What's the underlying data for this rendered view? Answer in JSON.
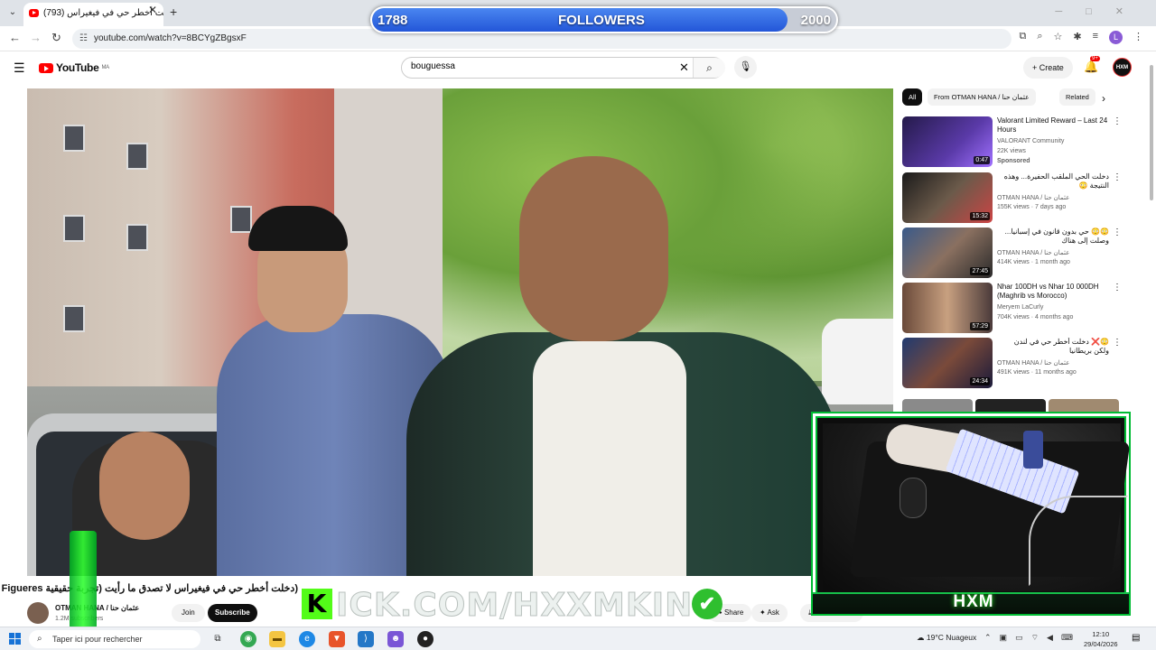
{
  "browser": {
    "tab_title": "(793) دخلت أخطر حي في فيغيراس",
    "url": "youtube.com/watch?v=8BCYgZBgsxF"
  },
  "overlay": {
    "followers_current": "1788",
    "followers_label": "FOLLOWERS",
    "followers_goal": "2000",
    "followers_progress": 0.894,
    "kick_letter": "K",
    "kick_text": "ICK.COM/HXXMKING",
    "check_glyph": "✔",
    "cam_label": "HXM"
  },
  "youtube": {
    "logo_text": "YouTube",
    "logo_region": "MA",
    "search_value": "bouguessa",
    "create_label": "Create",
    "notif_count": "9+",
    "account_initials": "HXM"
  },
  "video": {
    "title": "(دخلت أخطر حي في فيغيراس لا تصدق ما رأيت (تجربة حقيقية Figueres",
    "channel_name": "OTMAN HANA / عثمان حنا",
    "channel_subs": "1.2M subscribers",
    "join_label": "Join",
    "subscribe_label": "Subscribe",
    "share_label": "Share",
    "ask_label": "Ask",
    "download_label": "Download"
  },
  "sidebar": {
    "chips": [
      "All",
      "From OTMAN HANA / عثمان حنا",
      "Related"
    ],
    "recs": [
      {
        "title": "Valorant Limited Reward – Last 24 Hours",
        "line1": "VALORANT Community",
        "line2": "22K views",
        "line3": "Sponsored",
        "duration": "0:47"
      },
      {
        "title": "دخلت الحي الملقب الحفيرة... وهذه النتيجة 😳",
        "line1": "OTMAN HANA / عثمان حنا",
        "line2": "155K views · 7 days ago",
        "duration": "15:32"
      },
      {
        "title": "😳😳 حي بدون قانون في إسبانيا... وصلت إلى هناك",
        "line1": "OTMAN HANA / عثمان حنا",
        "line2": "414K views · 1 month ago",
        "duration": "27:45"
      },
      {
        "title": "Nhar 100DH vs Nhar 10 000DH (Maghrib vs Morocco)",
        "line1": "Meryem LaCurly",
        "line2": "704K views · 4 months ago",
        "duration": "57:29"
      },
      {
        "title": "😳❌ دخلت أخطر حي في لندن ولكن بريطانيا",
        "line1": "OTMAN HANA / عثمان حنا",
        "line2": "491K views · 11 months ago",
        "duration": "24:34"
      }
    ]
  },
  "taskbar": {
    "search_placeholder": "Taper ici pour rechercher",
    "weather": "19°C Nuageux",
    "time": "12:10",
    "date": "29/04/2026"
  },
  "colors": {
    "accent_red": "#ff0000",
    "kick_green": "#53fc18",
    "followers_blue": "#2f66e0"
  }
}
